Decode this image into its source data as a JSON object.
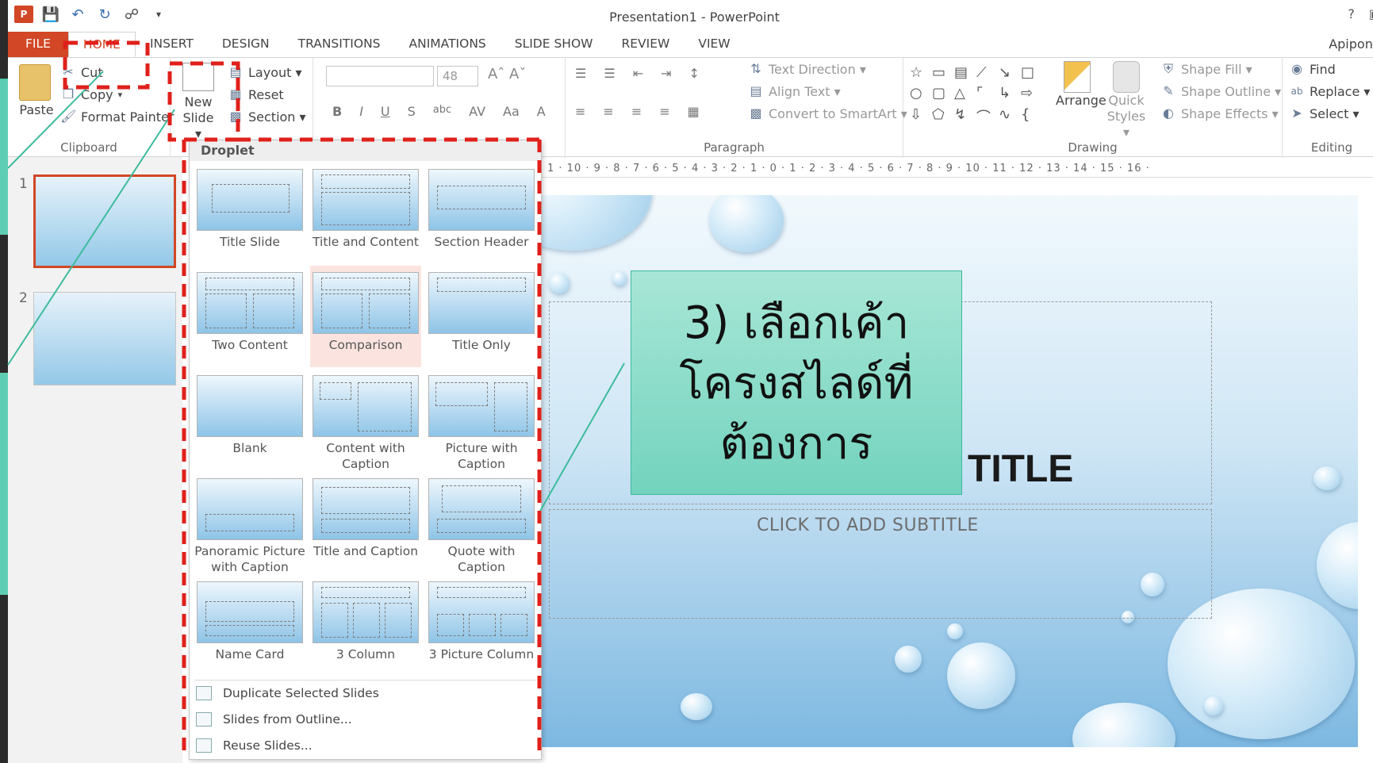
{
  "window": {
    "title": "Presentation1 - PowerPoint",
    "user": "Apipong",
    "help": "?"
  },
  "tabs": [
    "FILE",
    "HOME",
    "INSERT",
    "DESIGN",
    "TRANSITIONS",
    "ANIMATIONS",
    "SLIDE SHOW",
    "REVIEW",
    "VIEW"
  ],
  "clipboard": {
    "paste": "Paste",
    "cut": "Cut",
    "copy": "Copy",
    "format_painter": "Format Painter",
    "label": "Clipboard"
  },
  "slides": {
    "new_slide_line1": "New",
    "new_slide_line2": "Slide ▾",
    "layout": "Layout ▾",
    "reset": "Reset",
    "section": "Section ▾"
  },
  "font": {
    "size": "48"
  },
  "paragraph": {
    "text_direction": "Text Direction ▾",
    "align_text": "Align Text ▾",
    "convert": "Convert to SmartArt ▾",
    "label": "Paragraph"
  },
  "drawing": {
    "arrange": "Arrange",
    "quick_styles_line1": "Quick",
    "quick_styles_line2": "Styles ▾",
    "shape_fill": "Shape Fill ▾",
    "shape_outline": "Shape Outline ▾",
    "shape_effects": "Shape Effects ▾",
    "label": "Drawing"
  },
  "editing": {
    "find": "Find",
    "replace": "Replace ▾",
    "select": "Select ▾",
    "label": "Editing"
  },
  "ruler": "1 · 10 · 9 · 8 · 7 · 6 · 5 · 4 · 3 · 2 · 1 · 0 · 1 · 2 · 3 · 4 · 5 · 6 · 7 · 8 · 9 · 10 · 11 · 12 · 13 · 14 · 15 · 16 ·",
  "thumbnails": [
    "1",
    "2"
  ],
  "dropdown": {
    "header": "Droplet",
    "layouts": [
      {
        "name": "Title Slide"
      },
      {
        "name": "Title and Content"
      },
      {
        "name": "Section Header"
      },
      {
        "name": "Two Content"
      },
      {
        "name": "Comparison"
      },
      {
        "name": "Title Only"
      },
      {
        "name": "Blank"
      },
      {
        "name": "Content with Caption"
      },
      {
        "name": "Picture with Caption"
      },
      {
        "name": "Panoramic Picture with Caption"
      },
      {
        "name": "Title and Caption"
      },
      {
        "name": "Quote with Caption"
      },
      {
        "name": "Name Card"
      },
      {
        "name": "3 Column"
      },
      {
        "name": "3 Picture Column"
      }
    ],
    "actions": [
      "Duplicate Selected Slides",
      "Slides from Outline...",
      "Reuse Slides..."
    ]
  },
  "slide": {
    "title": "TITLE",
    "subtitle": "CLICK TO ADD SUBTITLE"
  },
  "annotation": {
    "line1": "3) เลือกเค้า",
    "line2": "โครงสไลด์ที่",
    "line3": "ต้องการ",
    "color": "#72d3bd",
    "highlight_color": "#e0201b"
  }
}
